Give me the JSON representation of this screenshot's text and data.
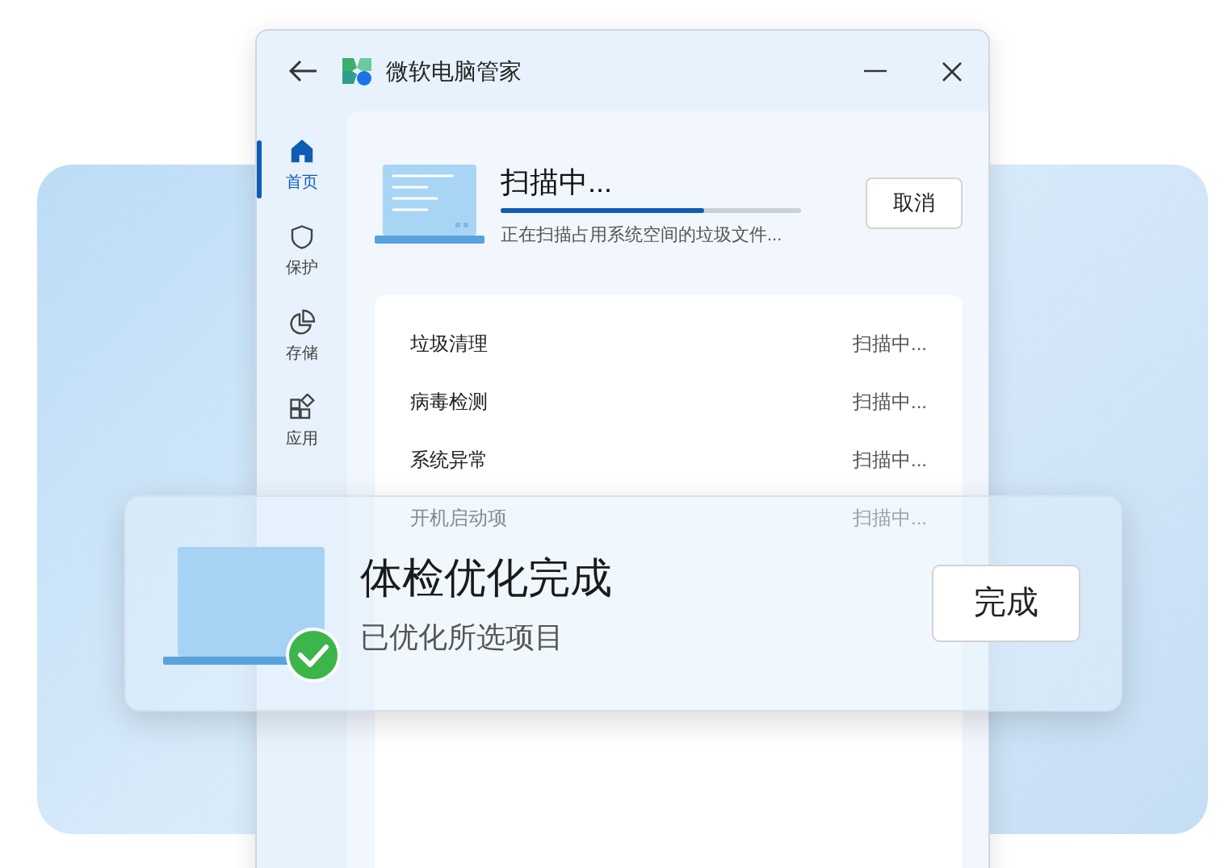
{
  "window": {
    "title": "微软电脑管家"
  },
  "sidebar": {
    "items": [
      {
        "label": "首页",
        "kind": "home",
        "selected": true
      },
      {
        "label": "保护",
        "kind": "shield",
        "selected": false
      },
      {
        "label": "存储",
        "kind": "pie",
        "selected": false
      },
      {
        "label": "应用",
        "kind": "apps",
        "selected": false
      }
    ]
  },
  "scan": {
    "title": "扫描中...",
    "level": 0.68,
    "subtitle": "正在扫描占用系统空间的垃圾文件...",
    "cancel_button": "取消"
  },
  "scan_items": [
    {
      "name": "垃圾清理",
      "status": "扫描中..."
    },
    {
      "name": "病毒检测",
      "status": "扫描中..."
    },
    {
      "name": "系统异常",
      "status": "扫描中..."
    },
    {
      "name": "开机启动项",
      "status": "扫描中..."
    }
  ],
  "notification": {
    "title": "体检优化完成",
    "subtitle": "已优化所选项目",
    "button": "完成"
  }
}
